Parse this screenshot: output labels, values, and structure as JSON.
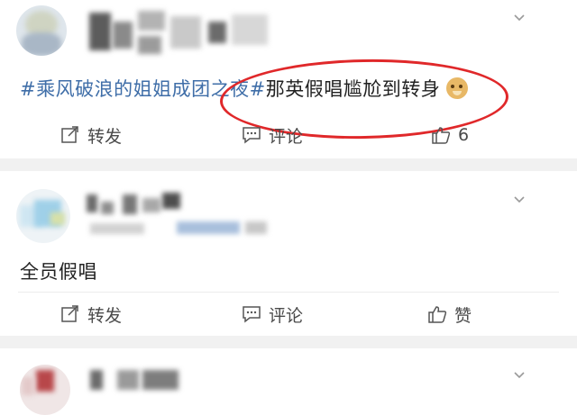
{
  "posts": [
    {
      "text_topic": "#乘风破浪的姐姐成团之夜#",
      "text_main": "那英假唱尴尬到转身",
      "emoji": "doge-emoji",
      "actions": {
        "repost": "转发",
        "comment": "评论",
        "like": "6"
      }
    },
    {
      "text_main": "全员假唱",
      "actions": {
        "repost": "转发",
        "comment": "评论",
        "like": "赞"
      }
    }
  ],
  "colors": {
    "topic": "#3f6ea8",
    "highlight": "#e0282a",
    "gap": "#f1f1f1"
  },
  "icons": [
    "chevron-down-icon",
    "repost-icon",
    "comment-icon",
    "like-icon"
  ]
}
